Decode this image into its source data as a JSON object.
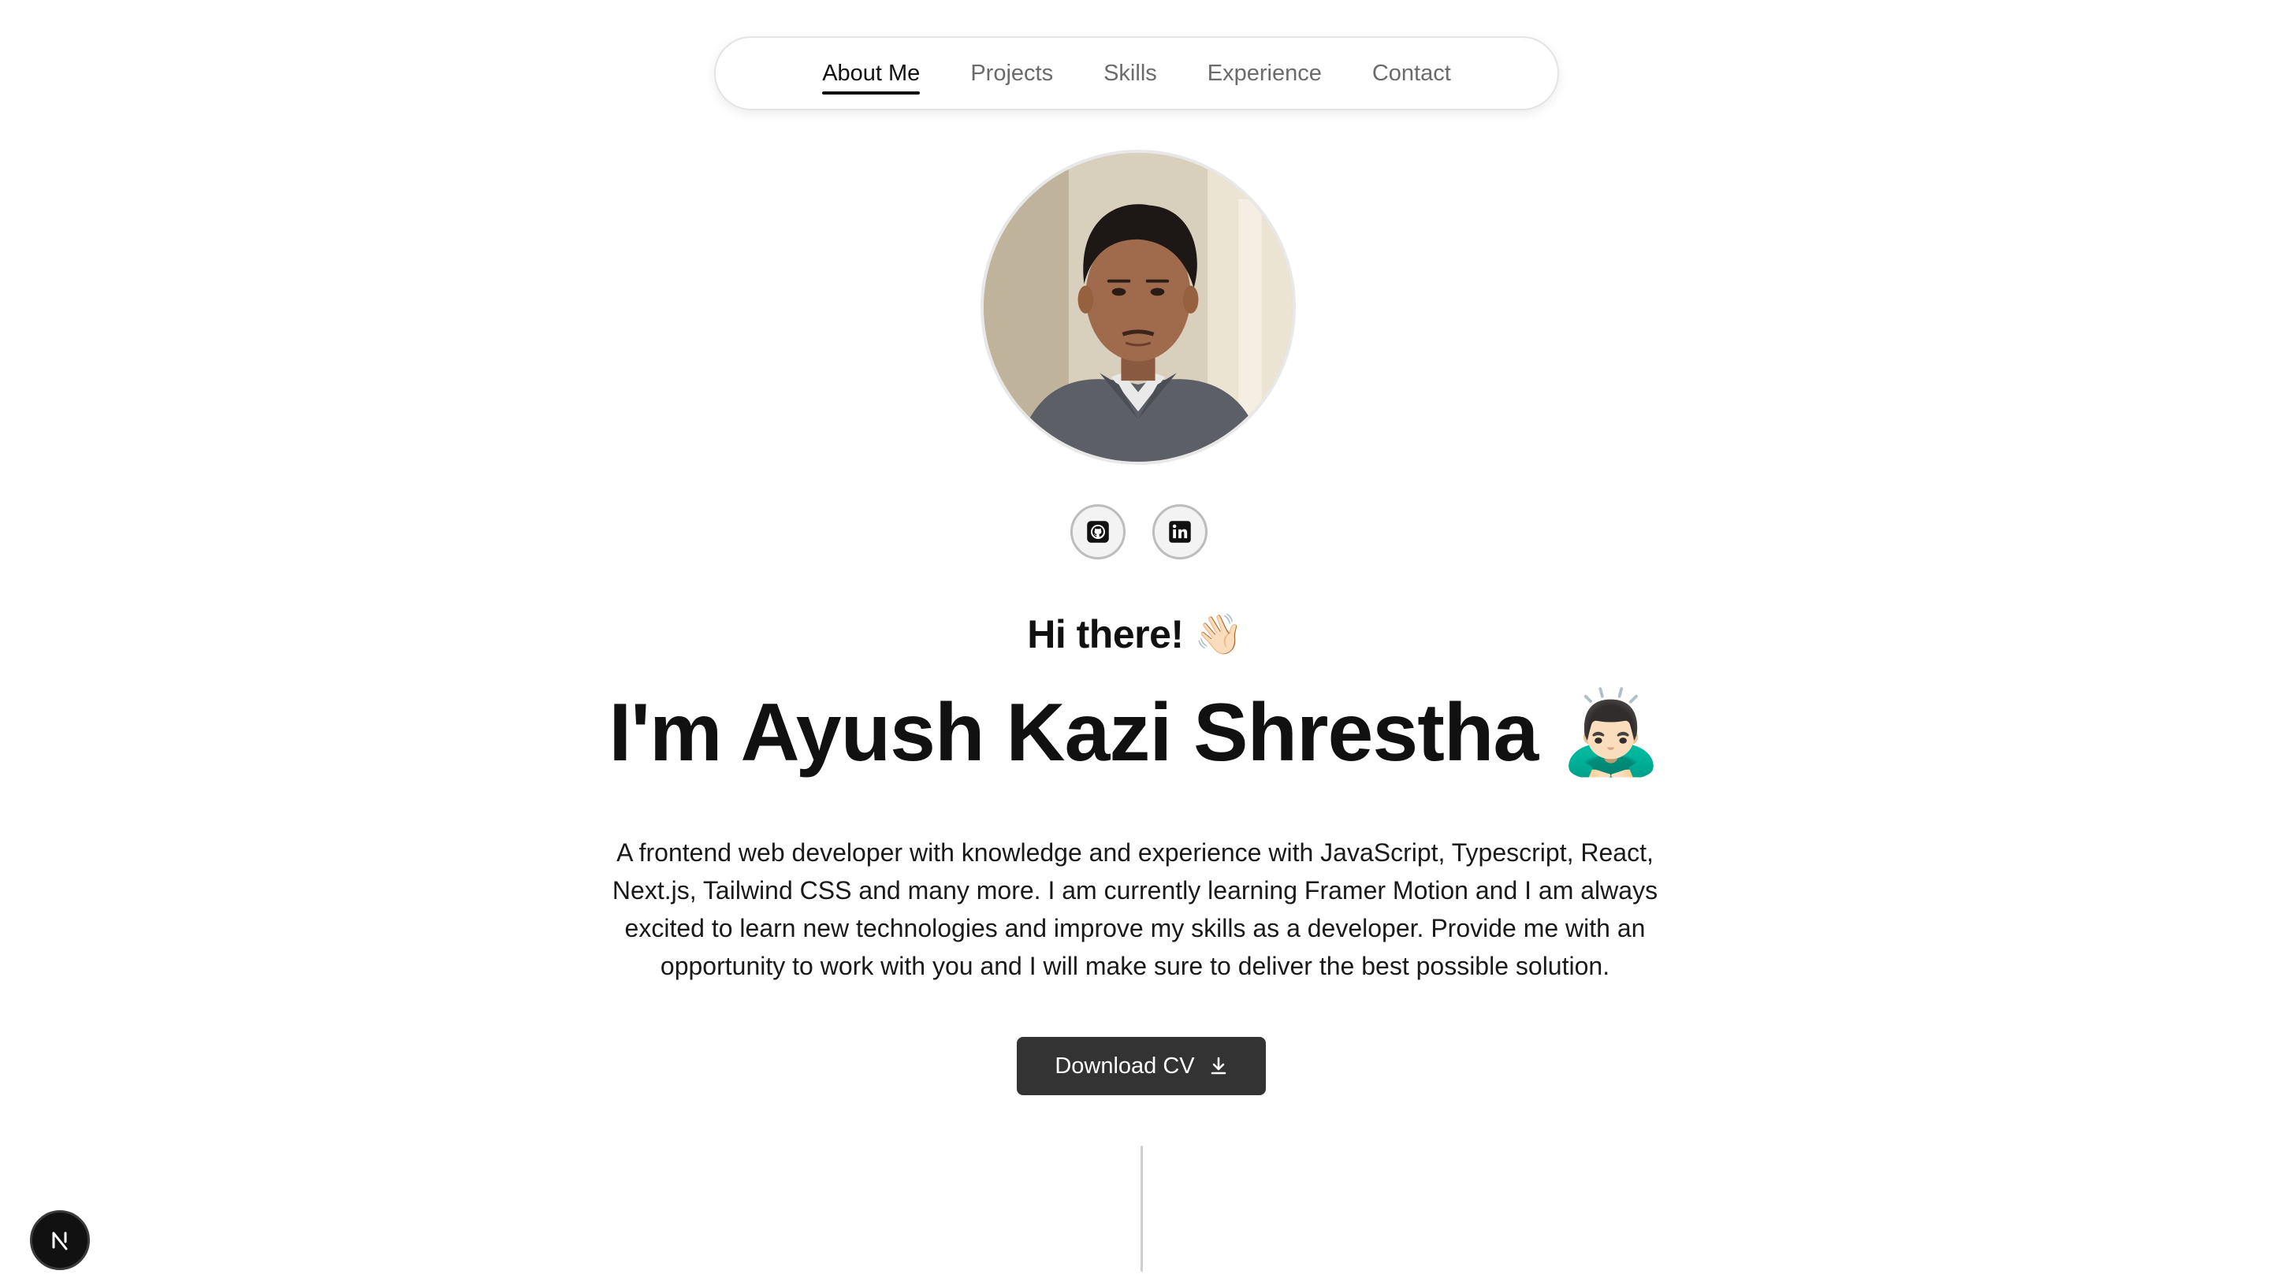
{
  "nav": {
    "items": [
      {
        "label": "About Me",
        "active": true
      },
      {
        "label": "Projects",
        "active": false
      },
      {
        "label": "Skills",
        "active": false
      },
      {
        "label": "Experience",
        "active": false
      },
      {
        "label": "Contact",
        "active": false
      }
    ]
  },
  "hero": {
    "greeting": "Hi there! 👋🏻",
    "name": "I'm Ayush Kazi Shrestha 🙇🏻‍♂️",
    "bio": "A frontend web developer with knowledge and experience with JavaScript, Typescript, React, Next.js, Tailwind CSS and many more. I am currently learning Framer Motion and I am always excited to learn new technologies and improve my skills as a developer. Provide me with an opportunity to work with you and I will make sure to deliver the best possible solution.",
    "cv_button_label": "Download CV"
  },
  "icons": {
    "social": [
      "github-icon",
      "linkedin-icon"
    ],
    "cv": "download-icon",
    "badge": "nextjs-n-icon"
  },
  "colors": {
    "button_bg": "#333333",
    "text": "#111111",
    "nav_muted": "#6b6b6b"
  }
}
